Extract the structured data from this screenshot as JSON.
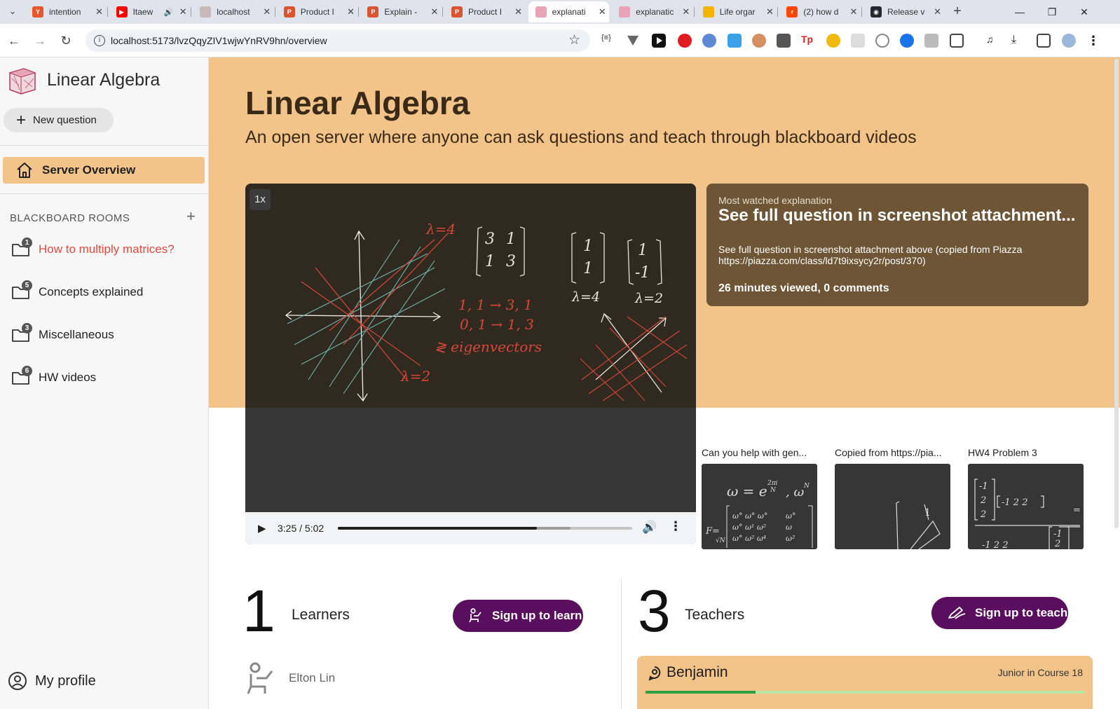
{
  "browser": {
    "tabs": [
      {
        "title": "intention",
        "color": "#e8562a",
        "glyph": "Y"
      },
      {
        "title": "Itaew",
        "color": "#ff0000",
        "glyph": "▶",
        "audio": true
      },
      {
        "title": "localhost",
        "color": "#c9b8b8",
        "glyph": ""
      },
      {
        "title": "Product I",
        "color": "#da552f",
        "glyph": "P"
      },
      {
        "title": "Explain -",
        "color": "#da552f",
        "glyph": "P"
      },
      {
        "title": "Product I",
        "color": "#da552f",
        "glyph": "P"
      },
      {
        "title": "explanati",
        "color": "#e9a3b7",
        "glyph": "",
        "active": true
      },
      {
        "title": "explanatic",
        "color": "#e9a3b7",
        "glyph": ""
      },
      {
        "title": "Life orgar",
        "color": "#f4b400",
        "glyph": ""
      },
      {
        "title": "(2) how d",
        "color": "#ff4500",
        "glyph": "r"
      },
      {
        "title": "Release v",
        "color": "#24292f",
        "glyph": "◉"
      }
    ],
    "url": "localhost:5173/lvzQqyZIV1wjwYnRV9hn/overview",
    "new_tab": "+",
    "close_glyph": "✕"
  },
  "sidebar": {
    "app_title": "Linear Algebra",
    "new_question_label": "New question",
    "server_overview_label": "Server Overview",
    "rooms_header": "BLACKBOARD ROOMS",
    "rooms_add": "+",
    "rooms": [
      {
        "label": "How to multiply matrices?",
        "badge": "1",
        "active": true
      },
      {
        "label": "Concepts explained",
        "badge": "5"
      },
      {
        "label": "Miscellaneous",
        "badge": "3"
      },
      {
        "label": "HW videos",
        "badge": "6"
      }
    ],
    "profile_label": "My profile"
  },
  "main": {
    "title": "Linear Algebra",
    "subtitle": "An open server where anyone can ask questions and teach through blackboard videos",
    "video": {
      "speed": "1x",
      "time": "3:25 / 5:02",
      "progress_played": 0.675,
      "progress_buffered": 0.79
    },
    "most_watched": {
      "label": "Most watched explanation",
      "title": "See full question in screenshot attachment...",
      "description": "See full question in screenshot attachment above (copied from Piazza https://piazza.com/class/ld7t9ixsycy2r/post/370)",
      "stats": "26 minutes viewed, 0 comments"
    },
    "thumbnails": [
      {
        "caption": "Can you help with gen..."
      },
      {
        "caption": "Copied from https://pia..."
      },
      {
        "caption": "HW4 Problem 3"
      }
    ],
    "learners": {
      "count": "1",
      "label": "Learners",
      "cta": "Sign up to learn"
    },
    "teachers": {
      "count": "3",
      "label": "Teachers",
      "cta": "Sign up to teach"
    },
    "learner_list": [
      {
        "name": "Elton Lin"
      }
    ],
    "teacher_list": [
      {
        "name": "Benjamin",
        "meta": "Junior in Course 18",
        "progress": 0.25
      }
    ]
  },
  "colors": {
    "accent_orange": "#f3c48a",
    "card_brown": "#6e5535",
    "cta_purple": "#5a0f5e",
    "active_room_red": "#e04a3f"
  }
}
